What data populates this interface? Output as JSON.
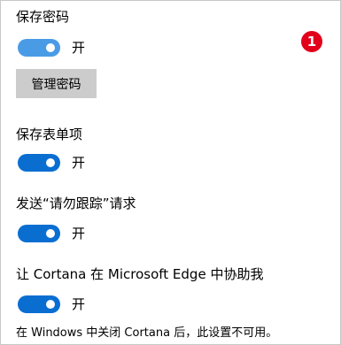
{
  "colors": {
    "toggle_on": "#0a6ed1",
    "toggle_on_faded": "#4a9be6",
    "badge": "#e2001a",
    "button_bg": "#cccccc"
  },
  "save_passwords": {
    "label": "保存密码",
    "toggle_state": "开",
    "manage_button": "管理密码"
  },
  "badge": {
    "number": "1"
  },
  "save_forms": {
    "label": "保存表单项",
    "toggle_state": "开"
  },
  "do_not_track": {
    "label": "发送“请勿跟踪”请求",
    "toggle_state": "开"
  },
  "cortana": {
    "label": "让 Cortana 在 Microsoft Edge 中协助我",
    "toggle_state": "开",
    "note": "在 Windows 中关闭 Cortana 后，此设置不可用。"
  }
}
